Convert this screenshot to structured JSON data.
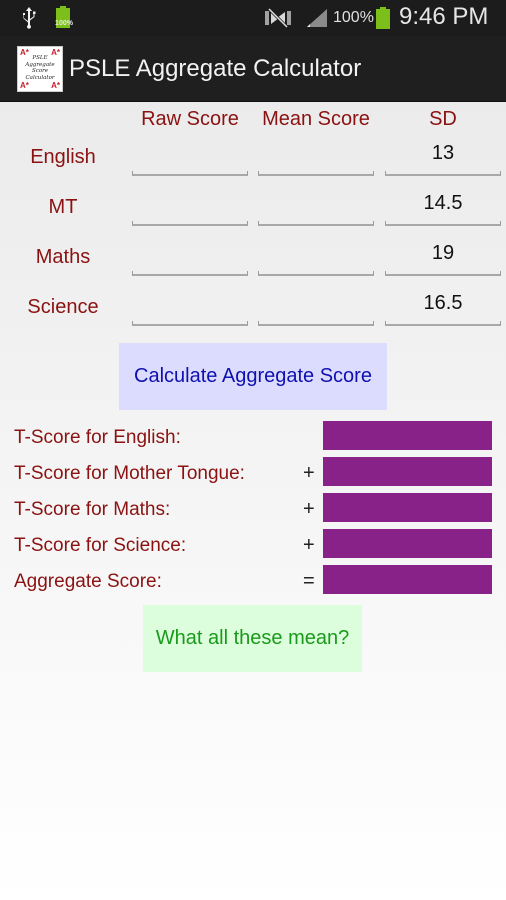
{
  "status_bar": {
    "small_battery_label": "100%",
    "battery_percent": "100%",
    "time": "9:46 PM",
    "icons": [
      "usb-icon",
      "battery-charging-icon",
      "mute-icon",
      "signal-icon",
      "battery-icon"
    ]
  },
  "action_bar": {
    "title": "PSLE Aggregate Calculator",
    "app_icon": {
      "corner_mark": "A*",
      "lines": [
        "PSLE",
        "Aggregate",
        "Score",
        "Calculator"
      ]
    }
  },
  "table": {
    "headers": {
      "raw": "Raw Score",
      "mean": "Mean Score",
      "sd": "SD"
    },
    "rows": [
      {
        "subject": "English",
        "raw": "",
        "mean": "",
        "sd": "13"
      },
      {
        "subject": "MT",
        "raw": "",
        "mean": "",
        "sd": "14.5"
      },
      {
        "subject": "Maths",
        "raw": "",
        "mean": "",
        "sd": "19"
      },
      {
        "subject": "Science",
        "raw": "",
        "mean": "",
        "sd": "16.5"
      }
    ]
  },
  "calculate_button": "Calculate Aggregate Score",
  "results": [
    {
      "label": "T-Score for English:",
      "operator": "",
      "value": ""
    },
    {
      "label": "T-Score for Mother Tongue:",
      "operator": "+",
      "value": ""
    },
    {
      "label": "T-Score for Maths:",
      "operator": "+",
      "value": ""
    },
    {
      "label": "T-Score for Science:",
      "operator": "+",
      "value": ""
    },
    {
      "label": "Aggregate Score:",
      "operator": "=",
      "value": ""
    }
  ],
  "help_button": "What all these mean?",
  "colors": {
    "label_text": "#8b1212",
    "result_box": "#882288",
    "calculate_bg": "#dcdcff",
    "calculate_text": "#1010b0",
    "help_bg": "#dcfedc",
    "help_text": "#1a9a1a",
    "battery_green": "#7cbf1a"
  }
}
